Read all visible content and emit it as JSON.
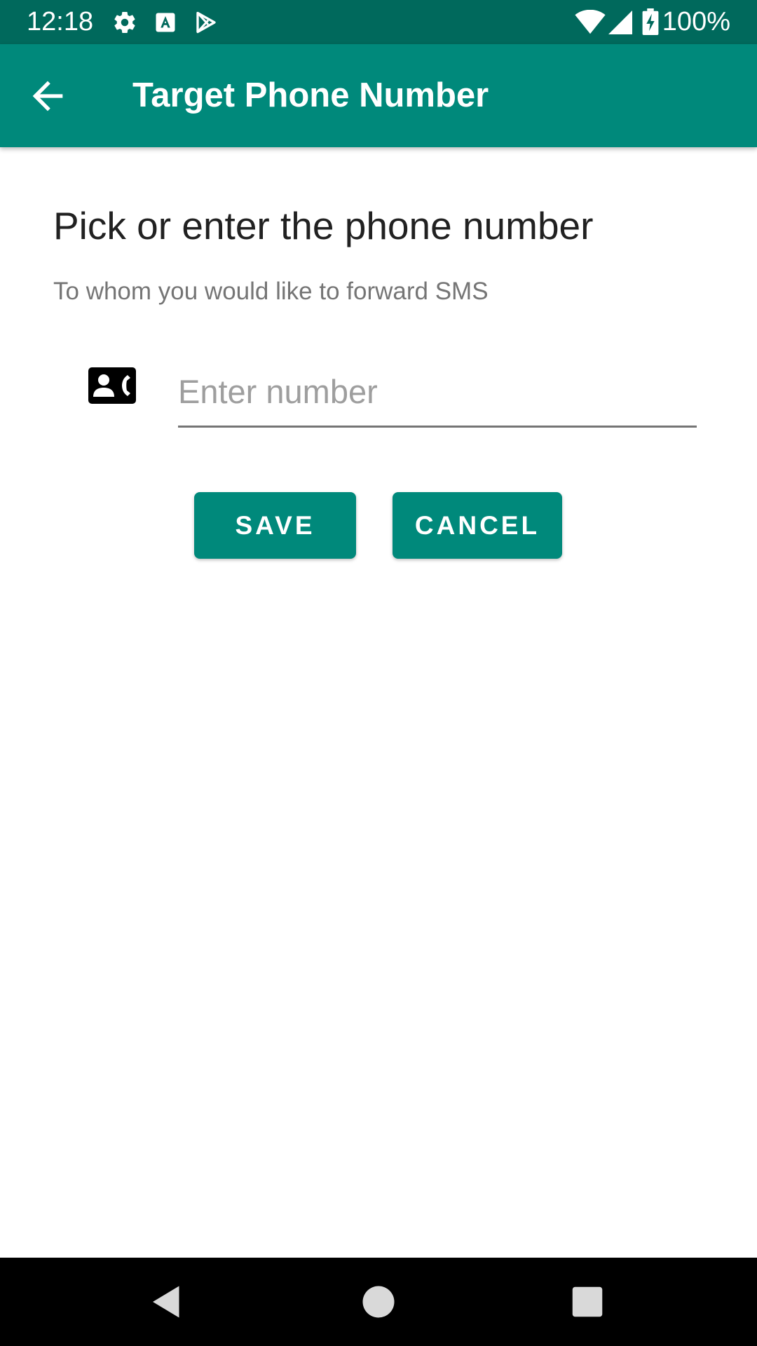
{
  "status_bar": {
    "time": "12:18",
    "battery_text": "100%",
    "icons": [
      "gear-icon",
      "font-a-icon",
      "play-store-icon",
      "wifi-icon",
      "signal-icon",
      "battery-charging-icon"
    ]
  },
  "app_bar": {
    "title": "Target Phone Number",
    "back_icon": "arrow-left-icon"
  },
  "main": {
    "heading": "Pick or enter the phone number",
    "subheading": "To whom you would like to forward SMS",
    "phone_input": {
      "value": "",
      "placeholder": "Enter number"
    },
    "contact_icon": "contact-phone-icon",
    "save_label": "SAVE",
    "cancel_label": "CANCEL"
  },
  "nav_bar": {
    "icons": [
      "back-triangle-icon",
      "home-circle-icon",
      "recents-square-icon"
    ]
  },
  "colors": {
    "status_bar": "#00695c",
    "app_bar": "#00897b",
    "button": "#00897b",
    "nav_bar": "#000000"
  }
}
